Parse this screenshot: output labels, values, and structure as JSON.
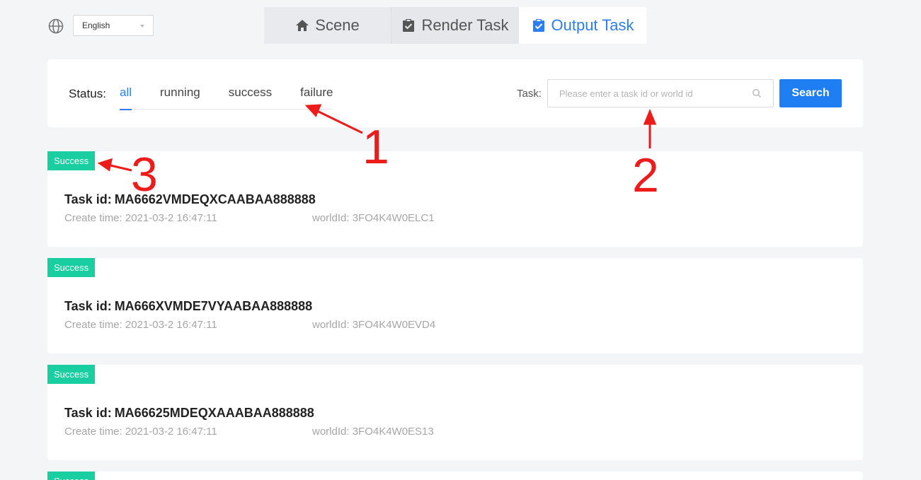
{
  "language": {
    "selected": "English"
  },
  "top_tabs": [
    {
      "label": "Scene",
      "icon": "home-icon"
    },
    {
      "label": "Render Task",
      "icon": "clipboard-icon"
    },
    {
      "label": "Output Task",
      "icon": "clipboard-check-icon",
      "active": true
    }
  ],
  "filter": {
    "status_label": "Status:",
    "status_tabs": [
      "all",
      "running",
      "success",
      "failure"
    ],
    "task_label": "Task:",
    "search_placeholder": "Please enter a task id or world id",
    "search_button": "Search"
  },
  "tasks": [
    {
      "status": "Success",
      "id_label": "Task id:",
      "id": "MA6662VMDEQXCAABAA888888",
      "create_time": "Create time: 2021-03-2 16:47:11",
      "world_id": "worldId: 3FO4K4W0ELC1"
    },
    {
      "status": "Success",
      "id_label": "Task id:",
      "id": "MA666XVMDE7VYAABAA888888",
      "create_time": "Create time: 2021-03-2 16:47:11",
      "world_id": "worldId: 3FO4K4W0EVD4"
    },
    {
      "status": "Success",
      "id_label": "Task id:",
      "id": "MA66625MDEQXAAABAA888888",
      "create_time": "Create time: 2021-03-2 16:47:11",
      "world_id": "worldId: 3FO4K4W0ES13"
    },
    {
      "status": "Success"
    }
  ],
  "annotations": [
    "1",
    "2",
    "3"
  ],
  "colors": {
    "accent": "#1f7ff2",
    "success": "#19cea0",
    "annotation": "#ee1b1b"
  }
}
